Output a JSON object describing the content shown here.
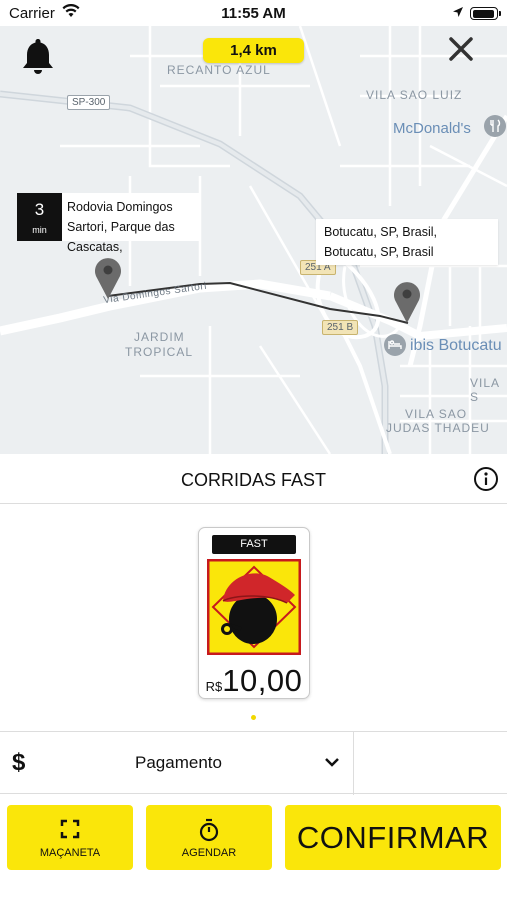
{
  "status_bar": {
    "carrier": "Carrier",
    "time": "11:55 AM"
  },
  "map": {
    "distance": "1,4 km",
    "neighborhoods": [
      "RECANTO AZUL",
      "VILA SAO LUIZ",
      "JARDIM",
      "TROPICAL",
      "VILA SAO",
      "JUDAS THADEU",
      "VILA S"
    ],
    "road_labels": [
      "SP-300",
      "Via Domingos Sartori",
      "251 A",
      "251 B"
    ],
    "pois": [
      "McDonald's",
      "ibis Botucatu"
    ],
    "eta": {
      "value": "3",
      "unit": "min"
    },
    "origin": "Rodovia Domingos Sartori, Parque das Cascatas,",
    "destination": "Botucatu, SP, Brasil, Botucatu, SP, Brasil"
  },
  "section": {
    "title": "CORRIDAS FAST"
  },
  "ride_option": {
    "tag": "FAST",
    "currency": "R$",
    "price": "10,00"
  },
  "payment": {
    "icon_text": "$",
    "label": "Pagamento"
  },
  "actions": {
    "macaneta": "MAÇANETA",
    "agendar": "AGENDAR",
    "confirm": "CONFIRMAR"
  },
  "colors": {
    "accent": "#fae60a",
    "dark": "#111111"
  },
  "icons": [
    "bell-icon",
    "close-icon",
    "info-icon",
    "dollar-icon",
    "chevron-down-icon",
    "expand-icon",
    "timer-icon",
    "map-pin-icon"
  ]
}
